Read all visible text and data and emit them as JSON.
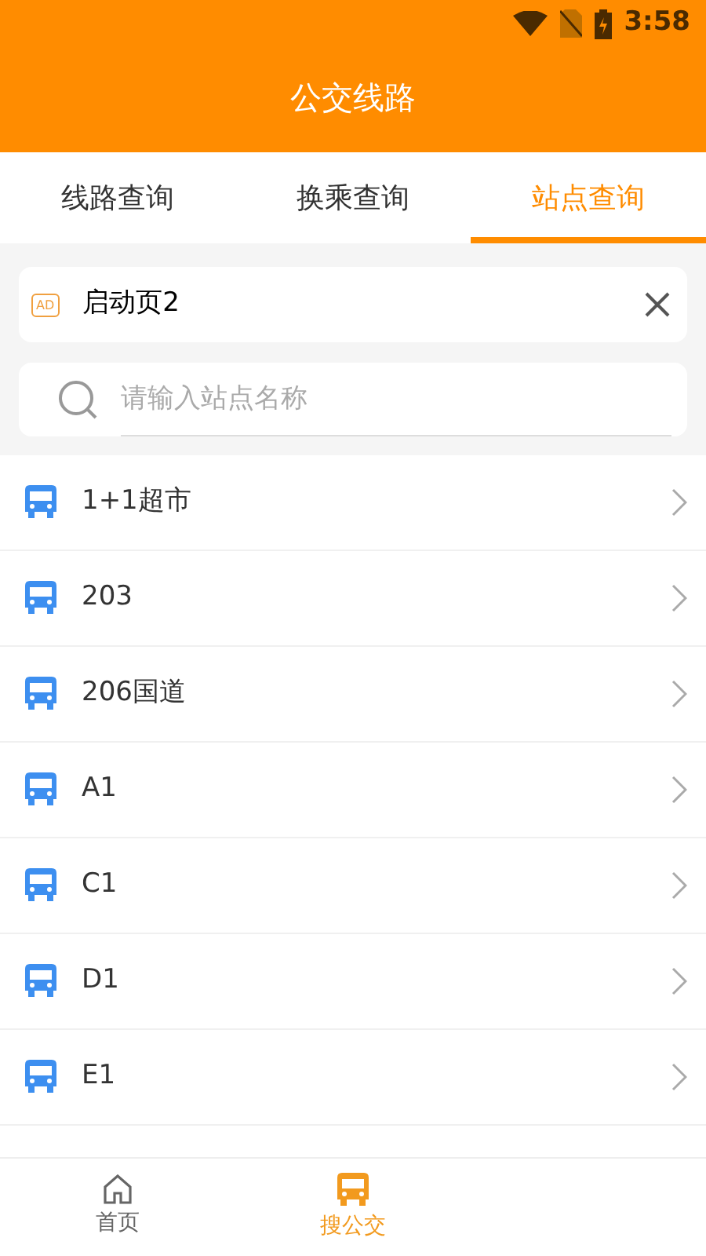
{
  "status_bar": {
    "time": "3:58"
  },
  "header": {
    "title": "公交线路"
  },
  "tabs": [
    {
      "label": "线路查询",
      "selected": false
    },
    {
      "label": "换乘查询",
      "selected": false
    },
    {
      "label": "站点查询",
      "selected": true
    }
  ],
  "ad_banner": {
    "badge": "AD",
    "text": "启动页2"
  },
  "search": {
    "placeholder": "请输入站点名称"
  },
  "stations": [
    {
      "name": "1+1超市"
    },
    {
      "name": "203"
    },
    {
      "name": "206国道"
    },
    {
      "name": "A1"
    },
    {
      "name": "C1"
    },
    {
      "name": "D1"
    },
    {
      "name": "E1"
    }
  ],
  "bottom_nav": [
    {
      "label": "首页",
      "kind": "home",
      "selected": false
    },
    {
      "label": "搜公交",
      "kind": "bus",
      "selected": true
    }
  ]
}
